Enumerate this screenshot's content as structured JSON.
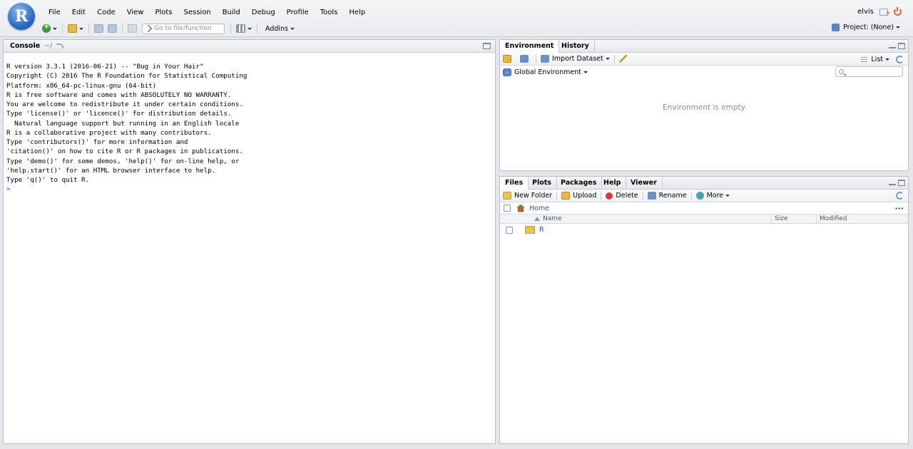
{
  "menu": [
    "File",
    "Edit",
    "Code",
    "View",
    "Plots",
    "Session",
    "Build",
    "Debug",
    "Profile",
    "Tools",
    "Help"
  ],
  "logo_letter": "R",
  "user": {
    "name": "elvis"
  },
  "toolbar": {
    "goto_placeholder": "Go to file/function",
    "addins_label": "Addins"
  },
  "project": {
    "label": "Project: (None)"
  },
  "console": {
    "title": "Console",
    "path": "~/",
    "lines": [
      "R version 3.3.1 (2016-06-21) -- \"Bug in Your Hair\"",
      "Copyright (C) 2016 The R Foundation for Statistical Computing",
      "Platform: x86_64-pc-linux-gnu (64-bit)",
      "",
      "R is free software and comes with ABSOLUTELY NO WARRANTY.",
      "You are welcome to redistribute it under certain conditions.",
      "Type 'license()' or 'licence()' for distribution details.",
      "",
      "  Natural language support but running in an English locale",
      "",
      "R is a collaborative project with many contributors.",
      "Type 'contributors()' for more information and",
      "'citation()' on how to cite R or R packages in publications.",
      "",
      "Type 'demo()' for some demos, 'help()' for on-line help, or",
      "'help.start()' for an HTML browser interface to help.",
      "Type 'q()' to quit R.",
      ""
    ],
    "prompt": ">"
  },
  "env": {
    "tabs": [
      "Environment",
      "History"
    ],
    "import_label": "Import Dataset",
    "list_label": "List",
    "scope_label": "Global Environment",
    "empty_message": "Environment is empty"
  },
  "files": {
    "tabs": [
      "Files",
      "Plots",
      "Packages",
      "Help",
      "Viewer"
    ],
    "actions": {
      "new_folder": "New Folder",
      "upload": "Upload",
      "delete": "Delete",
      "rename": "Rename",
      "more": "More"
    },
    "breadcrumb": "Home",
    "more_dots": "···",
    "columns": {
      "name": "Name",
      "size": "Size",
      "modified": "Modified"
    },
    "rows": [
      {
        "name": "R"
      }
    ]
  },
  "colors": {
    "accent": "#2855a5",
    "prompt": "#2f5fb6",
    "logo": "#2d6cc5",
    "power": "#e2672c"
  }
}
